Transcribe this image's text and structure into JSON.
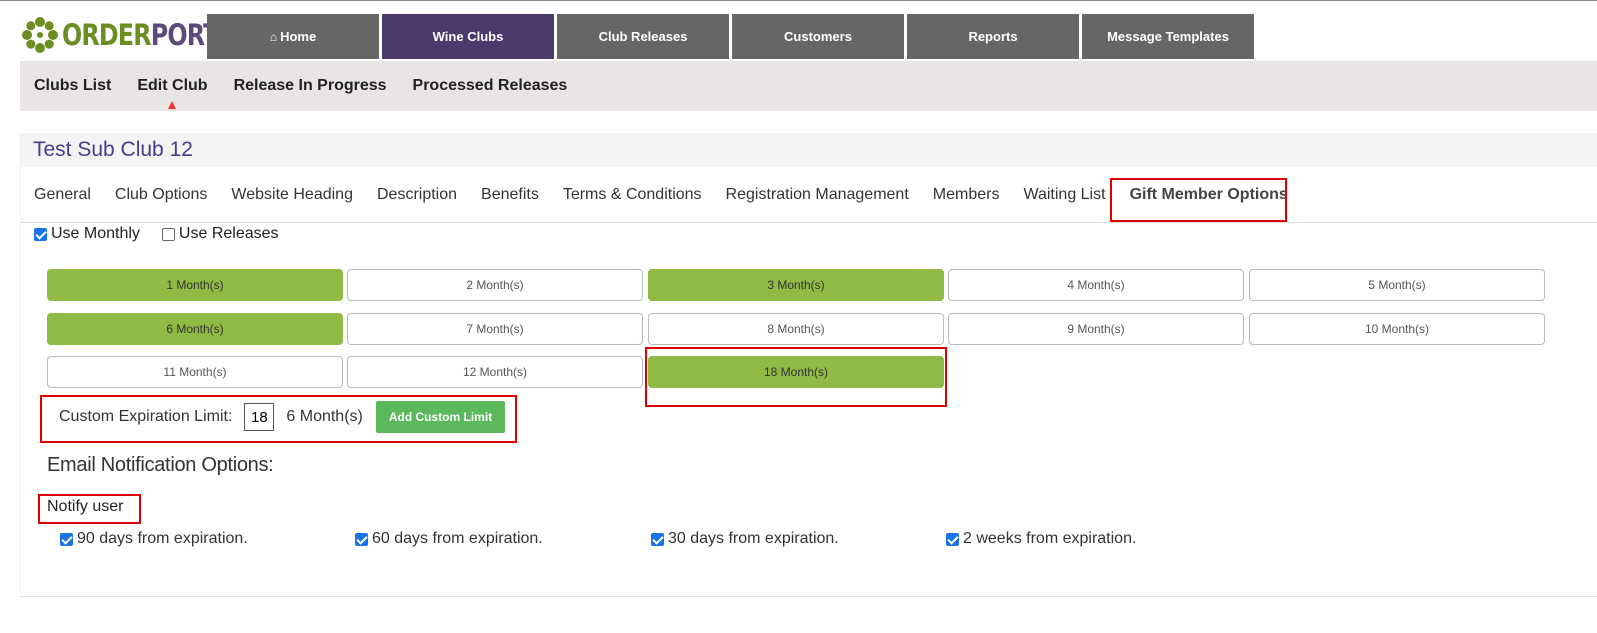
{
  "brand": {
    "logo_text_a": "ORDER",
    "logo_text_b": "PORT"
  },
  "topnav": [
    {
      "label": "Home",
      "icon": "home-icon"
    },
    {
      "label": "Wine Clubs",
      "active": true
    },
    {
      "label": "Club Releases"
    },
    {
      "label": "Customers"
    },
    {
      "label": "Reports"
    },
    {
      "label": "Message Templates"
    }
  ],
  "subnav": [
    {
      "label": "Clubs List"
    },
    {
      "label": "Edit Club",
      "active": true
    },
    {
      "label": "Release In Progress"
    },
    {
      "label": "Processed Releases"
    }
  ],
  "club": {
    "title": "Test Sub Club 12"
  },
  "tabs": [
    "General",
    "Club Options",
    "Website Heading",
    "Description",
    "Benefits",
    "Terms & Conditions",
    "Registration Management",
    "Members",
    "Waiting List",
    "Gift Member Options"
  ],
  "active_tab": "Gift Member Options",
  "usage": {
    "use_monthly": {
      "label": "Use Monthly",
      "checked": true
    },
    "use_releases": {
      "label": "Use Releases",
      "checked": false
    }
  },
  "months": [
    {
      "label": "1 Month(s)",
      "selected": true
    },
    {
      "label": "2 Month(s)",
      "selected": false
    },
    {
      "label": "3 Month(s)",
      "selected": true
    },
    {
      "label": "4 Month(s)",
      "selected": false
    },
    {
      "label": "5 Month(s)",
      "selected": false
    },
    {
      "label": "6 Month(s)",
      "selected": true
    },
    {
      "label": "7 Month(s)",
      "selected": false
    },
    {
      "label": "8 Month(s)",
      "selected": false
    },
    {
      "label": "9 Month(s)",
      "selected": false
    },
    {
      "label": "10 Month(s)",
      "selected": false
    },
    {
      "label": "11 Month(s)",
      "selected": false
    },
    {
      "label": "12 Month(s)",
      "selected": false
    },
    {
      "label": "18 Month(s)",
      "selected": true
    }
  ],
  "custom": {
    "label": "Custom Expiration Limit:",
    "value": "18",
    "unit_text": "6 Month(s)",
    "add_button": "Add Custom Limit"
  },
  "email": {
    "heading": "Email Notification Options:",
    "notify_label": "Notify user",
    "options": [
      {
        "label": "90 days from expiration.",
        "checked": true
      },
      {
        "label": "60 days from expiration.",
        "checked": true
      },
      {
        "label": "30 days from expiration.",
        "checked": true
      },
      {
        "label": "2 weeks from expiration.",
        "checked": true
      }
    ]
  },
  "colors": {
    "nav_gray": "#666666",
    "nav_active": "#4b3a6b",
    "month_selected": "#8fbb45",
    "add_button": "#5cb85c",
    "highlight_box": "#e00000"
  }
}
